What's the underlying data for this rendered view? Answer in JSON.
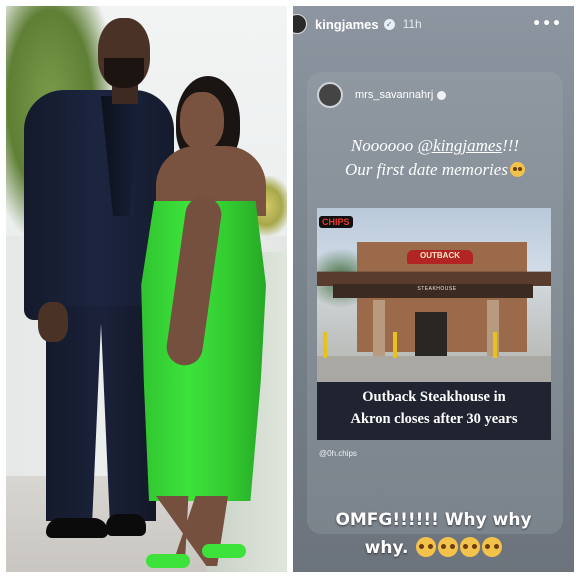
{
  "story": {
    "username": "kingjames",
    "time": "11h",
    "shared_post": {
      "username": "mrs_savannahrj",
      "quote_line1_prefix": "Noooooo ",
      "quote_mention": "@kingjames",
      "quote_line1_suffix": "!!!",
      "quote_line2": "Our first date memories",
      "news": {
        "logo": "CHIPS",
        "sign_text": "OUTBACK",
        "storefront_text": "STEAKHOUSE",
        "headline_line1": "Outback Steakhouse in",
        "headline_line2": "Akron closes after 30 years"
      },
      "credit": "@0h.chips"
    },
    "caption_line1": "OMFG!!!!!! Why why",
    "caption_line2": "why."
  },
  "colors": {
    "dress": "#3de33b",
    "story_bg": "#7f8791",
    "sign_red": "#b32424"
  },
  "icons": [
    "verified-icon",
    "more-icon",
    "pleading-face-emoji"
  ]
}
